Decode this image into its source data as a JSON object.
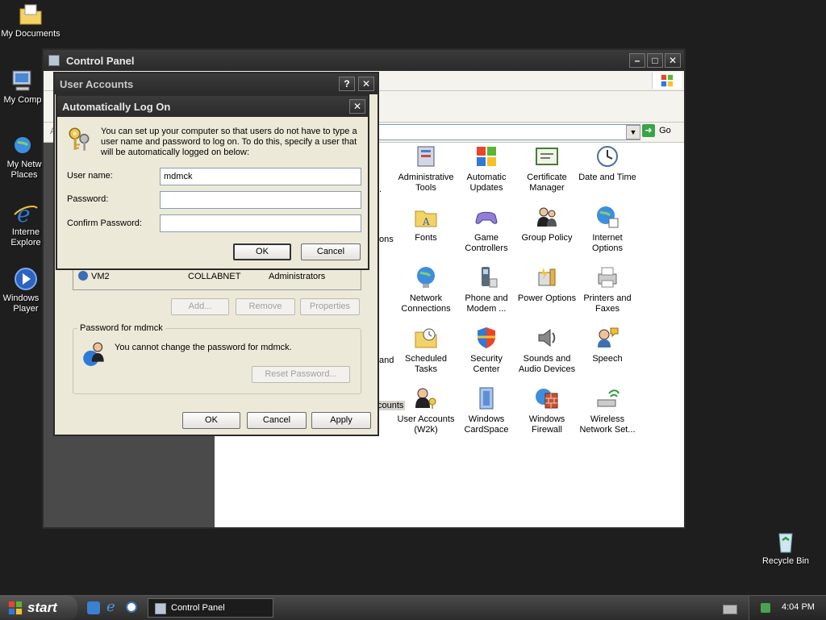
{
  "desktop": {
    "icons": [
      {
        "label": "My Documents"
      },
      {
        "label": "My Comp"
      },
      {
        "label": "My Netw\nPlaces"
      },
      {
        "label": "Interne\nExplore"
      },
      {
        "label": "Windows M\nPlayer"
      },
      {
        "label": "Recycle Bin"
      }
    ]
  },
  "control_panel": {
    "title": "Control Panel",
    "address_prefix": "A",
    "go_label": "Go",
    "peek_labels": [
      ".",
      "ons",
      "and",
      "counts"
    ],
    "icons": [
      {
        "label": "Administrative\nTools",
        "icon": "admin-tools-icon"
      },
      {
        "label": "Automatic\nUpdates",
        "icon": "automatic-updates-icon"
      },
      {
        "label": "Certificate\nManager",
        "icon": "certificate-icon"
      },
      {
        "label": "Date and Time",
        "icon": "clock-icon"
      },
      {
        "label": "Fonts",
        "icon": "fonts-folder-icon"
      },
      {
        "label": "Game\nControllers",
        "icon": "gamepad-icon"
      },
      {
        "label": "Group Policy",
        "icon": "group-policy-icon"
      },
      {
        "label": "Internet\nOptions",
        "icon": "internet-options-icon"
      },
      {
        "label": "Network\nConnections",
        "icon": "network-icon"
      },
      {
        "label": "Phone and\nModem ...",
        "icon": "phone-icon"
      },
      {
        "label": "Power Options",
        "icon": "power-icon"
      },
      {
        "label": "Printers and\nFaxes",
        "icon": "printer-icon"
      },
      {
        "label": "Scheduled\nTasks",
        "icon": "scheduled-tasks-icon"
      },
      {
        "label": "Security\nCenter",
        "icon": "shield-icon"
      },
      {
        "label": "Sounds and\nAudio Devices",
        "icon": "speaker-icon"
      },
      {
        "label": "Speech",
        "icon": "speech-icon"
      },
      {
        "label": "User Accounts\n(W2k)",
        "icon": "user-accounts-icon"
      },
      {
        "label": "Windows\nCardSpace",
        "icon": "cardspace-icon"
      },
      {
        "label": "Windows\nFirewall",
        "icon": "firewall-icon"
      },
      {
        "label": "Wireless\nNetwork Set...",
        "icon": "wireless-icon"
      }
    ]
  },
  "user_accounts": {
    "title": "User Accounts",
    "help_label": "?",
    "close_label": "✕",
    "row": {
      "name": "VM2",
      "domain": "COLLABNET",
      "group": "Administrators"
    },
    "buttons": {
      "add": "Add...",
      "remove": "Remove",
      "properties": "Properties"
    },
    "password_group_title": "Password for mdmck",
    "password_text": "You cannot change the password for mdmck.",
    "reset_password": "Reset Password...",
    "ok": "OK",
    "cancel": "Cancel",
    "apply": "Apply"
  },
  "auto_logon": {
    "title": "Automatically Log On",
    "close_label": "✕",
    "description": "You can set up your computer so that users do not have to type a user name and password to log on. To do this, specify a user that will be automatically logged on below:",
    "username_label": "User name:",
    "username_value": "mdmck",
    "password_label": "Password:",
    "confirm_label": "Confirm Password:",
    "ok": "OK",
    "cancel": "Cancel"
  },
  "taskbar": {
    "start_label": "start",
    "task_label": "Control Panel",
    "clock": "4:04 PM"
  }
}
